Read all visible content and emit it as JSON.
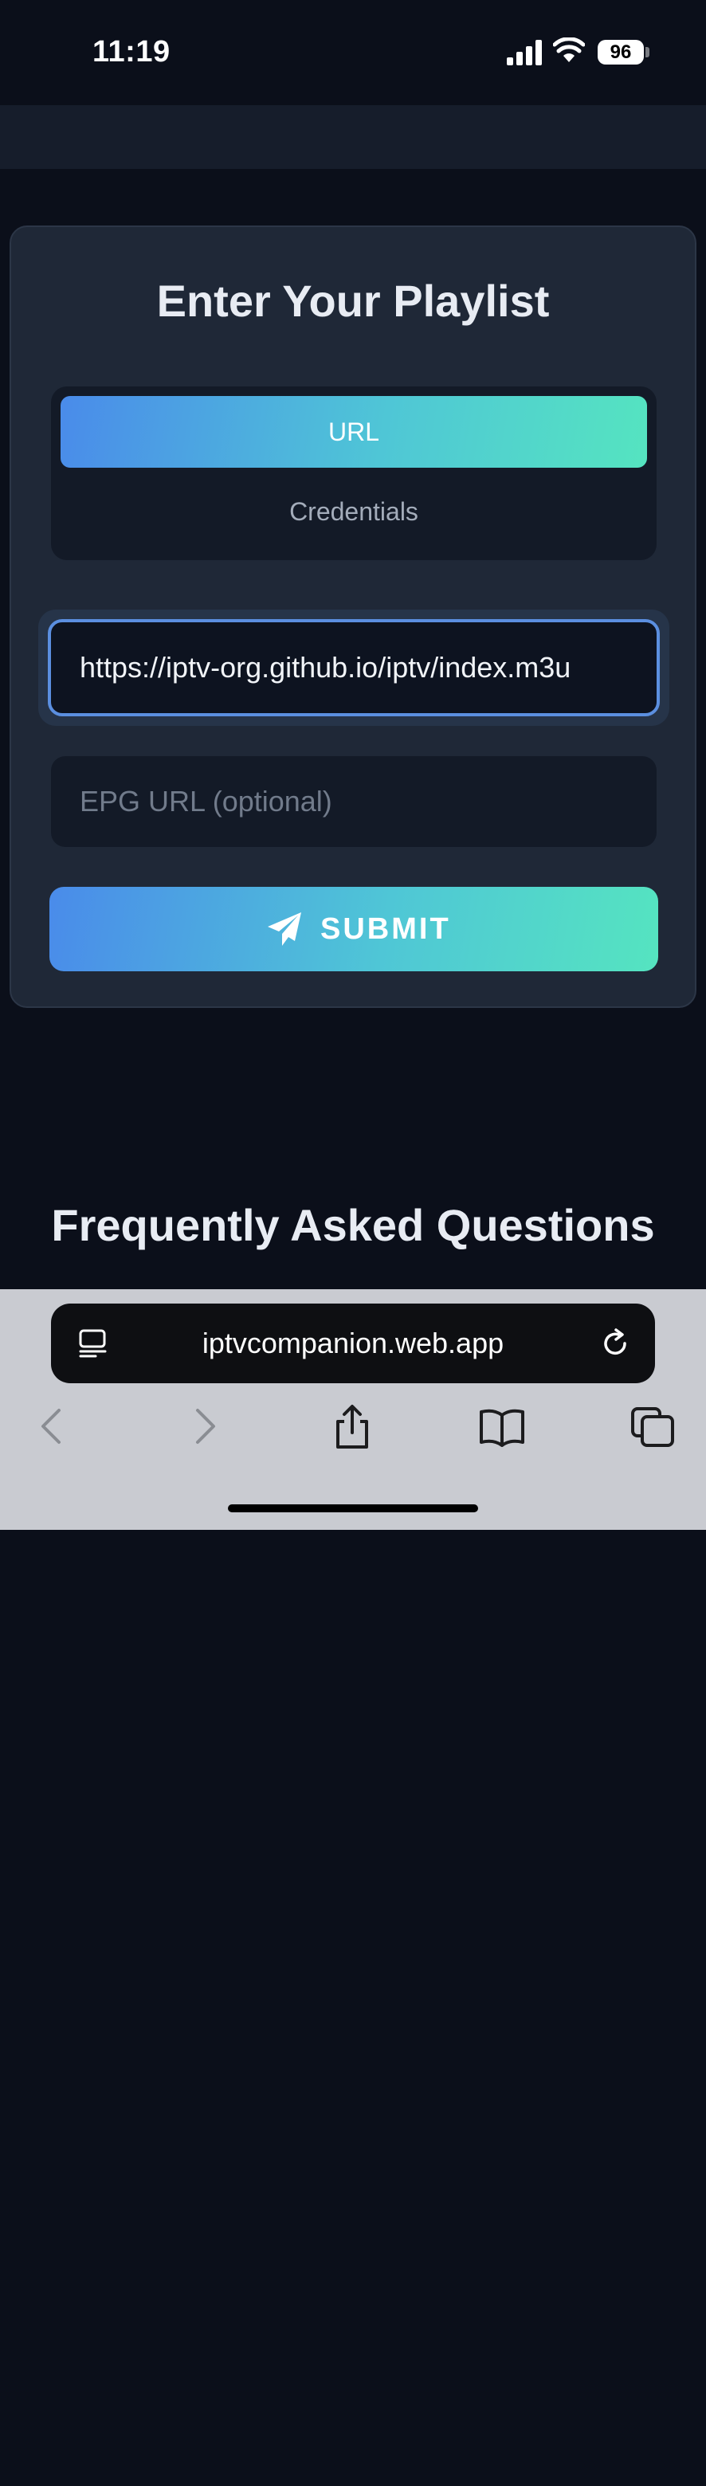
{
  "status_bar": {
    "time": "11:19",
    "battery": "96"
  },
  "card": {
    "title": "Enter Your Playlist",
    "tabs": [
      {
        "label": "URL",
        "active": true
      },
      {
        "label": "Credentials",
        "active": false
      }
    ],
    "url_value": "https://iptv-org.github.io/iptv/index.m3u",
    "epg_placeholder": "EPG URL (optional)",
    "submit_label": "SUBMIT"
  },
  "faq": {
    "heading": "Frequently Asked Questions"
  },
  "browser": {
    "address": "iptvcompanion.web.app"
  },
  "colors": {
    "background": "#0b0f1a",
    "card": "#1f2837",
    "gradient_start": "#4a8bea",
    "gradient_end": "#55e4c0",
    "focus_border": "#5b8fe0"
  },
  "icons": [
    "signal-icon",
    "wifi-icon",
    "battery-icon",
    "send-icon",
    "tabs-list-icon",
    "reload-icon",
    "back-icon",
    "forward-icon",
    "share-icon",
    "bookmarks-icon",
    "tabs-icon"
  ]
}
